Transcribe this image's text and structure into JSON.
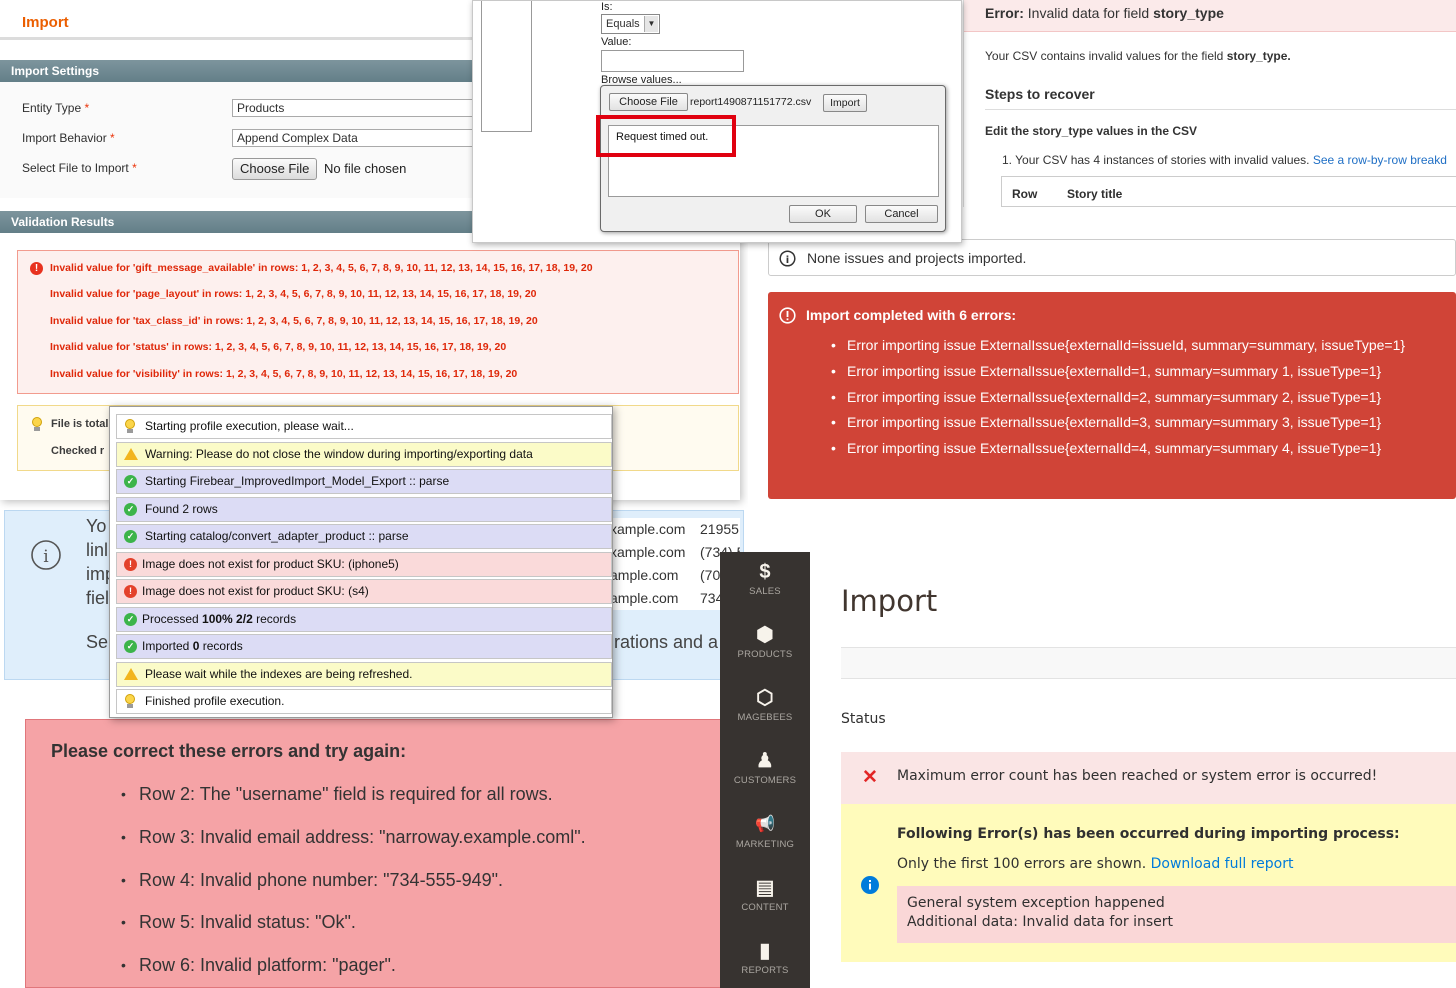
{
  "m1": {
    "title": "Import",
    "settings_header": "Import Settings",
    "entity_type_label": "Entity Type",
    "entity_type_value": "Products",
    "import_behavior_label": "Import Behavior",
    "import_behavior_value": "Append Complex Data",
    "select_file_label": "Select File to Import",
    "choose_file": "Choose File",
    "no_file": "No file chosen",
    "required_mark": "*",
    "validation_header": "Validation Results",
    "validation_errors": [
      "Invalid value for 'gift_message_available' in rows: 1, 2, 3, 4, 5, 6, 7, 8, 9, 10, 11, 12, 13, 14, 15, 16, 17, 18, 19, 20",
      "Invalid value for 'page_layout' in rows: 1, 2, 3, 4, 5, 6, 7, 8, 9, 10, 11, 12, 13, 14, 15, 16, 17, 18, 19, 20",
      "Invalid value for 'tax_class_id' in rows: 1, 2, 3, 4, 5, 6, 7, 8, 9, 10, 11, 12, 13, 14, 15, 16, 17, 18, 19, 20",
      "Invalid value for 'status' in rows: 1, 2, 3, 4, 5, 6, 7, 8, 9, 10, 11, 12, 13, 14, 15, 16, 17, 18, 19, 20",
      "Invalid value for 'visibility' in rows: 1, 2, 3, 4, 5, 6, 7, 8, 9, 10, 11, 12, 13, 14, 15, 16, 17, 18, 19, 20"
    ],
    "info_lines": [
      "File is total",
      "Checked r"
    ]
  },
  "dialog": {
    "is_label": "Is:",
    "is_value": "Equals",
    "value_label": "Value:",
    "browse_label": "Browse values...",
    "choose_file": "Choose File",
    "file_name": "report1490871151772.csv",
    "import_btn": "Import",
    "message": "Request timed out.",
    "ok": "OK",
    "cancel": "Cancel"
  },
  "story": {
    "error_prefix": "Error:",
    "error_text": "Invalid data for field",
    "error_field": "story_type",
    "csv_text": "Your CSV contains invalid values for the field",
    "csv_field": "story_type.",
    "steps_heading": "Steps to recover",
    "edit_heading": "Edit the story_type values in the CSV",
    "step1": "1. Your CSV has 4 instances of stories with invalid values.",
    "step1_link": "See a row-by-row breakd",
    "col_row": "Row",
    "col_title": "Story title"
  },
  "jira": {
    "info": "None issues and projects imported.",
    "heading": "Import completed with 6 errors:",
    "errors": [
      "Error importing issue ExternalIssue{externalId=issueId, summary=summary, issueType=1}",
      "Error importing issue ExternalIssue{externalId=1, summary=summary 1, issueType=1}",
      "Error importing issue ExternalIssue{externalId=2, summary=summary 2, issueType=1}",
      "Error importing issue ExternalIssue{externalId=3, summary=summary 3, issueType=1}",
      "Error importing issue ExternalIssue{externalId=4, summary=summary 4, issueType=1}"
    ]
  },
  "notice": {
    "fragments": [
      "Yo",
      "linl",
      "imp",
      "fiel",
      "Se"
    ],
    "tail": "rations and a"
  },
  "emails": [
    {
      "email": "xample.com",
      "tail": "21955"
    },
    {
      "email": "xample.com",
      "tail": "(734) 5"
    },
    {
      "email": "ample.com",
      "tail": "(70"
    },
    {
      "email": "ample.com",
      "tail": "734"
    }
  ],
  "log": [
    {
      "type": "info",
      "text": "Starting profile execution, please wait..."
    },
    {
      "type": "warn",
      "text": "Warning: Please do not close the window during importing/exporting data"
    },
    {
      "type": "ok",
      "text": "Starting Firebear_ImprovedImport_Model_Export :: parse"
    },
    {
      "type": "ok",
      "text": "Found 2 rows"
    },
    {
      "type": "ok",
      "text": "Starting catalog/convert_adapter_product :: parse"
    },
    {
      "type": "err",
      "text": "Image does not exist for product SKU: (iphone5)"
    },
    {
      "type": "err",
      "text": "Image does not exist for product SKU: (s4)"
    },
    {
      "type": "ok",
      "text": "Processed ",
      "bold": "100% 2/2",
      "after": " records"
    },
    {
      "type": "ok",
      "text": "Imported ",
      "bold": "0",
      "after": " records"
    },
    {
      "type": "warn",
      "text": "Please wait while the indexes are being refreshed."
    },
    {
      "type": "info",
      "text": "Finished profile execution."
    }
  ],
  "correction": {
    "title": "Please correct these errors and try again:",
    "items": [
      "Row 2: The \"username\" field is required for all rows.",
      "Row 3: Invalid email address: \"narroway.example.coml\".",
      "Row 4: Invalid phone number: \"734-555-949\".",
      "Row 5: Invalid status: \"Ok\".",
      "Row 6: Invalid platform: \"pager\"."
    ]
  },
  "m2": {
    "nav": [
      {
        "icon": "dollar-icon",
        "glyph": "$",
        "label": "SALES"
      },
      {
        "icon": "box-icon",
        "glyph": "⬢",
        "label": "PRODUCTS"
      },
      {
        "icon": "hexagon-icon",
        "glyph": "⬡",
        "label": "MAGEBEES"
      },
      {
        "icon": "person-icon",
        "glyph": "♟",
        "label": "CUSTOMERS"
      },
      {
        "icon": "megaphone-icon",
        "glyph": "📢",
        "label": "MARKETING"
      },
      {
        "icon": "layout-icon",
        "glyph": "▤",
        "label": "CONTENT"
      },
      {
        "icon": "bar-chart-icon",
        "glyph": "▮",
        "label": "REPORTS"
      }
    ],
    "title": "Import",
    "status_label": "Status",
    "error_msg": "Maximum error count has been reached or system error is occurred!",
    "warn_heading": "Following Error(s) has been occurred during importing process:",
    "warn_sub": "Only the first 100 errors are shown.",
    "warn_link": "Download full report",
    "exception_1": "General system exception happened",
    "exception_2": "Additional data: Invalid data for insert"
  },
  "colors": {
    "magento_orange": "#eb5e00",
    "jira_red": "#d04437",
    "pink": "#f5a3a6",
    "m2_sidebar": "#373330",
    "link_blue": "#007bdb"
  }
}
